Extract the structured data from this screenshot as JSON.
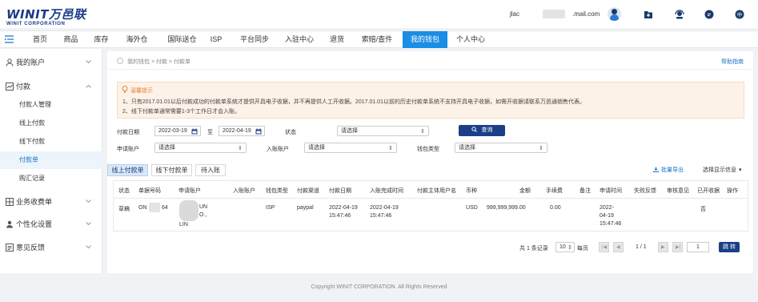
{
  "header": {
    "logo_main": "WINIT万邑联",
    "logo_sub": "WINIT CORPORATION",
    "user_id": "jlac",
    "user_mail": ".mail.com"
  },
  "nav": {
    "items": [
      "首页",
      "商品",
      "库存",
      "海外仓",
      "国际送仓",
      "ISP",
      "平台同步",
      "入驻中心",
      "退货",
      "索赔/查件",
      "我的钱包",
      "个人中心"
    ],
    "active_index": 10
  },
  "sidebar": {
    "my_account": "我的账户",
    "payment": "付款",
    "payment_items": [
      "付款人管理",
      "线上付款",
      "线下付款",
      "付款单",
      "购汇记录"
    ],
    "payment_active": "付款单",
    "business_fee": "业务收费单",
    "personalize": "个性化设置",
    "feedback": "意见反馈"
  },
  "breadcrumb": {
    "text": "我的钱包 > 付款 > 付款单",
    "help": "帮助指南"
  },
  "notice": {
    "title": "温馨提示",
    "line1": "1、只有2017.01.01以后付款成功的付款单系统才提供开具电子收据，并不再提供人工开收据。2017.01.01以前的历史付款单系统不支持开具电子收据，如需开收据请联系万邑通销售代表。",
    "line2": "2、线下付款单通常需要1-3个工作日才会入账。"
  },
  "filters": {
    "pay_date_label": "付款日期",
    "date_from": "2022-03-19",
    "date_sep": "至",
    "date_to": "2022-04-19",
    "status_label": "状态",
    "status_value": "请选择",
    "query_label": "查询",
    "apply_account_label": "申请账户",
    "apply_account_value": "请选择",
    "receive_account_label": "入账账户",
    "receive_account_value": "请选择",
    "wallet_type_label": "钱包类型",
    "wallet_type_value": "请选择"
  },
  "tabs": [
    "线上付款单",
    "线下付款单",
    "待入账"
  ],
  "tab_active": 0,
  "toolbar": {
    "export": "批量导出",
    "column_select": "选择显示信息"
  },
  "table": {
    "headers": [
      "状态",
      "单据号码",
      "申请账户",
      "入账账户",
      "钱包类型",
      "付款渠道",
      "付款日期",
      "入账完成时间",
      "付款主体用户名",
      "币种",
      "金额",
      "手续费",
      "备注",
      "申请时间",
      "失败反馈",
      "审核意见",
      "已开收据",
      "操作"
    ],
    "rows": [
      {
        "status": "草稿",
        "doc_no": "ON",
        "doc_no_tail": "64",
        "apply_account_a": "UN",
        "apply_account_b": "O.,",
        "apply_account_c": "LIN",
        "wallet_type": "ISP",
        "channel": "paypal",
        "pay_date": "2022-04-19",
        "pay_time": "15:47:46",
        "done_date": "2022-04-19",
        "done_time": "15:47:46",
        "currency": "USD",
        "amount": "999,999,999.00",
        "fee": "0.00",
        "apply_date": "2022-",
        "apply_date2": "04-19",
        "apply_time": "15:47:46",
        "receipt": "否"
      }
    ]
  },
  "pagination": {
    "summary": "共 1 条记录",
    "page_size": "10",
    "per_page": "每页",
    "page_info": "1 / 1",
    "page_input": "1",
    "go": "跳 转"
  },
  "footer": "Copyright WINIT CORPORATION. All Rights Reserved"
}
